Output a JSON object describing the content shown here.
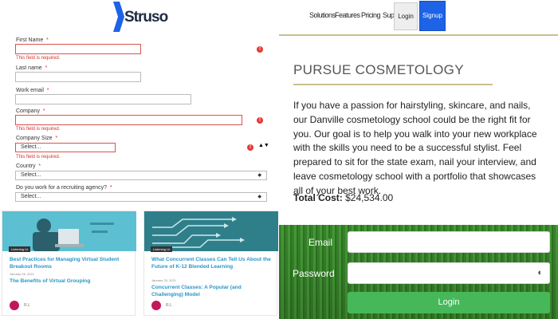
{
  "logo": {
    "text": "Struso"
  },
  "form": {
    "first_name": {
      "label": "First Name",
      "req": "*",
      "error": "This field is required."
    },
    "last_name": {
      "label": "Last name",
      "req": "*"
    },
    "work_email": {
      "label": "Work email",
      "req": "*"
    },
    "company": {
      "label": "Company",
      "req": "*",
      "error": "This field is required."
    },
    "company_size": {
      "label": "Company Size",
      "req": "*",
      "value": "Select...",
      "error": "This field is required."
    },
    "country": {
      "label": "Country",
      "req": "*",
      "value": "Select..."
    },
    "recruiting": {
      "label": "Do you work for a recruiting agency?",
      "req": "*",
      "value": "Select..."
    },
    "error_icon": "!"
  },
  "cards": [
    {
      "tag": "Listening Lit",
      "title": "Best Practices for Managing Virtual Student Breakout Rooms",
      "date": "January 26, 2021",
      "title2": "The Benefits of Virtual Grouping",
      "author": "R.L"
    },
    {
      "tag": "Listening Lit",
      "title": "What Concurrent Classes Can Tell Us About the Future of K-12 Blended Learning",
      "date": "January 25, 2021",
      "title2": "Concurrent Classes: A Popular (and Challenging) Model",
      "author": "R.L"
    }
  ],
  "nav": {
    "solutions": "Solutions",
    "features": "Features",
    "pricing": "Pricing",
    "support": "Support",
    "login": "Login",
    "signup": "Signup"
  },
  "program": {
    "title": "PURSUE COSMETOLOGY",
    "description": "If you have a passion for hairstyling, skincare, and nails, our Danville cosmetology school could be the right fit for you. Our goal is to help you walk into your new workplace with the skills you need to be a successful stylist. Feel prepared to sit for the state exam, nail your interview, and leave cosmetology school with a portfolio that showcases all of your best work.",
    "cost_label": "Total Cost:",
    "cost_value": "$24,534.00"
  },
  "login_form": {
    "email_label": "Email",
    "password_label": "Password",
    "button": "Login"
  },
  "colors": {
    "accent_blue": "#1e63e6",
    "login_green": "#46b85a",
    "error_red": "#d93025",
    "gold_rule": "#c9bf8f"
  }
}
